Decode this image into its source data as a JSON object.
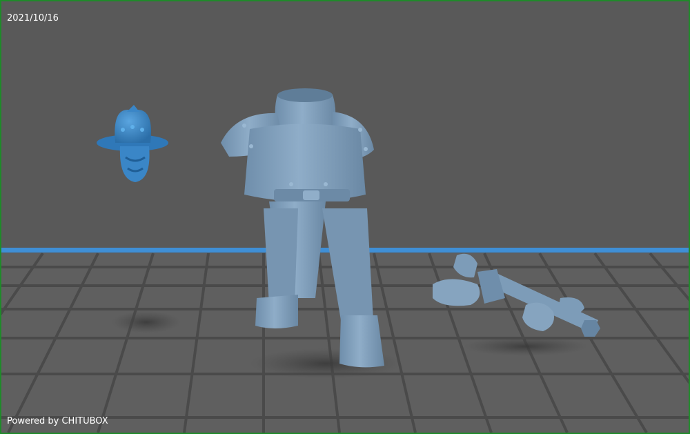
{
  "viewer": {
    "date_stamp": "2021/10/16",
    "footer_text": "Powered by CHITUBOX"
  },
  "scene": {
    "background_color": "#595959",
    "floor_color": "#5e5e5e",
    "grid_line_color": "#4a4a4a",
    "plate_edge_color": "#3f8fd6",
    "frame_color": "#1f8a2a",
    "model_color": "#7d9cb8",
    "helmet_color": "#3a86c7",
    "models": [
      {
        "id": "helmeted-head",
        "color": "#3a86c7"
      },
      {
        "id": "cloaked-body",
        "color": "#7d9cb8"
      },
      {
        "id": "pistol-hands",
        "color": "#7d9cb8"
      }
    ]
  }
}
